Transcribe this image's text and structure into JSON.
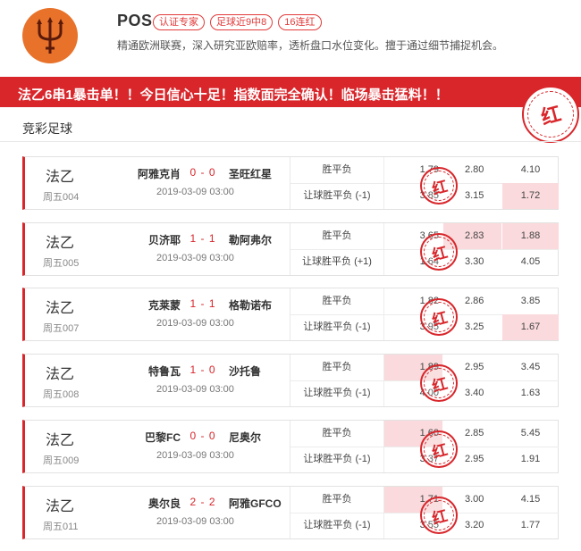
{
  "profile": {
    "name": "POS",
    "badges": [
      "认证专家",
      "足球近9中8",
      "16连红"
    ],
    "bio": "精通欧洲联赛，深入研究亚欧赔率，透析盘口水位变化。擅于通过细节捕捉机会。"
  },
  "banner": {
    "text": "法乙6串1暴击单！！今日信心十足！指数面完全确认！临场暴击猛料！！",
    "stamp": "红"
  },
  "section_title": "竞彩足球",
  "stamp_char": "红",
  "matches": [
    {
      "league": "法乙",
      "code": "周五004",
      "home": "阿雅克肖",
      "score": "0 - 0",
      "away": "圣旺红星",
      "datetime": "2019-03-09 03:00",
      "rows": [
        {
          "type": "胜平负",
          "odds": [
            "1.79",
            "2.80",
            "4.10"
          ]
        },
        {
          "type": "让球胜平负 (-1)",
          "odds": [
            "3.85",
            "3.15",
            "1.72"
          ]
        }
      ]
    },
    {
      "league": "法乙",
      "code": "周五005",
      "home": "贝济耶",
      "score": "1 - 1",
      "away": "勒阿弗尔",
      "datetime": "2019-03-09 03:00",
      "rows": [
        {
          "type": "胜平负",
          "odds": [
            "3.65",
            "2.83",
            "1.88"
          ]
        },
        {
          "type": "让球胜平负 (+1)",
          "odds": [
            "1.64",
            "3.30",
            "4.05"
          ]
        }
      ]
    },
    {
      "league": "法乙",
      "code": "周五007",
      "home": "克莱蒙",
      "score": "1 - 1",
      "away": "格勒诺布",
      "datetime": "2019-03-09 03:00",
      "rows": [
        {
          "type": "胜平负",
          "odds": [
            "1.82",
            "2.86",
            "3.85"
          ]
        },
        {
          "type": "让球胜平负 (-1)",
          "odds": [
            "3.95",
            "3.25",
            "1.67"
          ]
        }
      ]
    },
    {
      "league": "法乙",
      "code": "周五008",
      "home": "特鲁瓦",
      "score": "1 - 0",
      "away": "沙托鲁",
      "datetime": "2019-03-09 03:00",
      "rows": [
        {
          "type": "胜平负",
          "odds": [
            "1.89",
            "2.95",
            "3.45"
          ]
        },
        {
          "type": "让球胜平负 (-1)",
          "odds": [
            "4.00",
            "3.40",
            "1.63"
          ]
        }
      ]
    },
    {
      "league": "法乙",
      "code": "周五009",
      "home": "巴黎FC",
      "score": "0 - 0",
      "away": "尼奥尔",
      "datetime": "2019-03-09 03:00",
      "rows": [
        {
          "type": "胜平负",
          "odds": [
            "1.60",
            "2.85",
            "5.45"
          ]
        },
        {
          "type": "让球胜平负 (-1)",
          "odds": [
            "3.37",
            "2.95",
            "1.91"
          ]
        }
      ]
    },
    {
      "league": "法乙",
      "code": "周五011",
      "home": "奥尔良",
      "score": "2 - 2",
      "away": "阿雅GFCO",
      "datetime": "2019-03-09 03:00",
      "rows": [
        {
          "type": "胜平负",
          "odds": [
            "1.71",
            "3.00",
            "4.15"
          ]
        },
        {
          "type": "让球胜平负 (-1)",
          "odds": [
            "3.55",
            "3.20",
            "1.77"
          ]
        }
      ]
    }
  ]
}
